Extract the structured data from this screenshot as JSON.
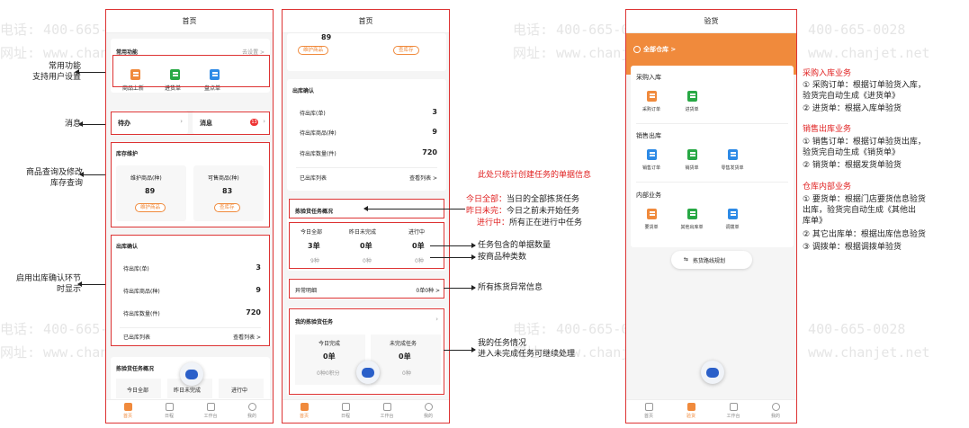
{
  "watermark": {
    "tel": "电话: 400-665-0028",
    "web": "网址: www.chanjet.net"
  },
  "phone1": {
    "title": "首页",
    "common": {
      "title": "常用功能",
      "link": "去设置 >",
      "items": [
        "商品上新",
        "进货单",
        "盘点单"
      ]
    },
    "todo": "待办",
    "msg": "消息",
    "msg_badge": "13",
    "stock": {
      "title": "库存维护",
      "a_label": "维护商品(种)",
      "a_val": "89",
      "a_btn": "维护商品",
      "b_label": "可售商品(种)",
      "b_val": "83",
      "b_btn": "查库存"
    },
    "out": {
      "title": "出库确认",
      "rows": [
        {
          "label": "待出库(单)",
          "val": "3"
        },
        {
          "label": "待出库商品(种)",
          "val": "9"
        },
        {
          "label": "待出库数量(件)",
          "val": "720"
        }
      ],
      "list": "已出库列表",
      "view": "查看列表 >"
    },
    "pick": {
      "title": "拣验货任务概况",
      "c1": "今日全部",
      "c2": "昨日未完成",
      "c3": "进行中"
    },
    "tabs": [
      "首页",
      "日程",
      "工作台",
      "我的"
    ]
  },
  "phone2": {
    "title": "首页",
    "chips": [
      "维护商品",
      "查库存"
    ],
    "top_num": "89",
    "out": {
      "title": "出库确认",
      "rows": [
        {
          "label": "待出库(单)",
          "val": "3"
        },
        {
          "label": "待出库商品(种)",
          "val": "9"
        },
        {
          "label": "待出库数量(件)",
          "val": "720"
        }
      ],
      "list": "已出库列表",
      "view": "查看列表 >"
    },
    "pick": {
      "title": "拣验货任务概况",
      "cols": [
        {
          "label": "今日全部",
          "val": "3单",
          "sub": "9种"
        },
        {
          "label": "昨日未完成",
          "val": "0单",
          "sub": "0种"
        },
        {
          "label": "进行中",
          "val": "0单",
          "sub": "0种"
        }
      ]
    },
    "abnormal": {
      "label": "异常明细",
      "val": "0单0种 >"
    },
    "mine": {
      "title": "我的拣验货任务",
      "cols": [
        {
          "label": "今日完成",
          "val": "0单",
          "sub": "0种0积分"
        },
        {
          "label": "未完成任务",
          "val": "0单",
          "sub": "0种"
        }
      ]
    },
    "tabs": [
      "首页",
      "日程",
      "工作台",
      "我的"
    ]
  },
  "phone3": {
    "title": "验货",
    "warehouse": "全部仓库 >",
    "s1": {
      "title": "采购入库",
      "items": [
        "采购订单",
        "进货单"
      ]
    },
    "s2": {
      "title": "销售出库",
      "items": [
        "销售订单",
        "销货单",
        "零售发货单"
      ]
    },
    "s3": {
      "title": "内部业务",
      "items": [
        "要货单",
        "其他出库单",
        "调拨单"
      ]
    },
    "route": "拣货路线规划",
    "tabs": [
      "首页",
      "验货",
      "工作台",
      "我的"
    ]
  },
  "annotations": {
    "a1": "常用功能\n支持用户设置",
    "a2": "消息",
    "a3": "商品查询及修改\n库存查询",
    "a4": "启用出库确认环节\n时显示",
    "m_head": "此处只统计创建任务的单据信息",
    "m1_k": "今日全部：",
    "m1_v": "当日的全部拣货任务",
    "m2_k": "昨日未完：",
    "m2_v": "今日之前未开始任务",
    "m3_k": "进行中：",
    "m3_v": "所有正在进行中任务",
    "m4": "任务包含的单据数量",
    "m5": "按商品种类数",
    "m6": "所有拣货异常信息",
    "m7": "我的任务情况\n进入未完成任务可继续处理"
  },
  "right": {
    "h1": "采购入库业务",
    "p1a": "① 采购订单：根据订单验货入库，\n     验货完自动生成《进货单》",
    "p1b": "② 进货单：根据入库单验货",
    "h2": "销售出库业务",
    "p2a": "① 销售订单：根据订单验货出库，\n     验货完自动生成《销货单》",
    "p2b": "② 销货单：根据发货单验货",
    "h3": "仓库内部业务",
    "p3a": "① 要货单：根据门店要货信息验货\n     出库，验货完自动生成《其他出\n     库单》",
    "p3b": "② 其它出库单：根据出库信息验货",
    "p3c": "③ 调拨单：根据调拨单验货"
  }
}
